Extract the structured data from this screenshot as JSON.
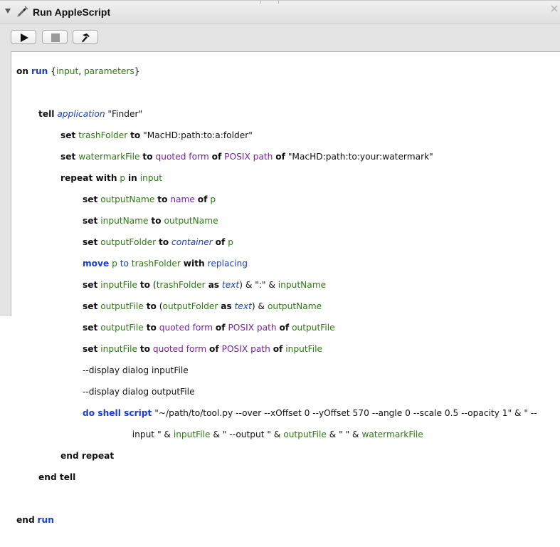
{
  "window": {
    "title": "Run AppleScript",
    "icon": "script-icon",
    "disclosure": "expanded"
  },
  "toolbar": {
    "buttons": [
      {
        "name": "run-button",
        "icon": "play-icon"
      },
      {
        "name": "stop-button",
        "icon": "stop-icon"
      },
      {
        "name": "compile-button",
        "icon": "hammer-icon"
      }
    ]
  },
  "colors": {
    "keyword": "#111111",
    "keyword_blue": "#1a3cd6",
    "variable": "#2d7a13",
    "property": "#7a1fa8",
    "class": "#1a3cd6"
  },
  "code": {
    "l1": {
      "on": "on",
      "run": "run",
      "rest1": " {",
      "input": "input",
      "comma": ", ",
      "parameters": "parameters",
      "close": "}"
    },
    "l3": {
      "tell": "tell",
      "application": "application",
      "rest": " \"Finder\""
    },
    "l4": {
      "set": "set",
      "trashFolder": "trashFolder",
      "to": "to",
      "str": " \"MacHD:path:to:a:folder\""
    },
    "l5": {
      "set": "set",
      "watermarkFile": "watermarkFile",
      "to": "to",
      "quoted": "quoted form",
      "of1": "of",
      "posix": "POSIX path",
      "of2": "of",
      "str": " \"MacHD:path:to:your:watermark\""
    },
    "l6": {
      "repeat": "repeat with",
      "p": "p",
      "in": "in",
      "input": "input"
    },
    "l7": {
      "set": "set",
      "outputName": "outputName",
      "to": "to",
      "name": "name",
      "of": "of",
      "p": "p"
    },
    "l8": {
      "set": "set",
      "inputName": "inputName",
      "to": "to",
      "outputName": "outputName"
    },
    "l9": {
      "set": "set",
      "outputFolder": "outputFolder",
      "to": "to",
      "container": "container",
      "of": "of",
      "p": "p"
    },
    "l10": {
      "move": "move",
      "p": "p",
      "to": "to",
      "trashFolder": "trashFolder",
      "with": "with",
      "replacing": "replacing"
    },
    "l11": {
      "set": "set",
      "inputFile": "inputFile",
      "to": "to",
      "open": " (",
      "trashFolder": "trashFolder",
      "as": "as",
      "text": "text",
      "rest": ") & \":\" & ",
      "inputName": "inputName"
    },
    "l12": {
      "set": "set",
      "outputFile": "outputFile",
      "to": "to",
      "open": " (",
      "outputFolder": "outputFolder",
      "as": "as",
      "text": "text",
      "rest": ") & ",
      "outputName": "outputName"
    },
    "l13": {
      "set": "set",
      "outputFile": "outputFile",
      "to": "to",
      "quoted": "quoted form",
      "of1": "of",
      "posix": "POSIX path",
      "of2": "of",
      "outputFile2": "outputFile"
    },
    "l14": {
      "set": "set",
      "inputFile": "inputFile",
      "to": "to",
      "quoted": "quoted form",
      "of1": "of",
      "posix": "POSIX path",
      "of2": "of",
      "inputFile2": "inputFile"
    },
    "l15": {
      "comment": "--display dialog inputFile"
    },
    "l16": {
      "comment": "--display dialog outputFile"
    },
    "l17": {
      "doshell": "do shell script",
      "str": " \"~/path/to/tool.py --over --xOffset 0 --yOffset 570 --angle 0 --scale 0.5 --opacity 1\" & \" --"
    },
    "l18": {
      "str": "input \" & ",
      "inputFile": "inputFile",
      "mid": " & \" --output \" & ",
      "outputFile": "outputFile",
      "mid2": " & \" \" & ",
      "watermarkFile": "watermarkFile"
    },
    "l19": {
      "end": "end repeat"
    },
    "l20": {
      "end": "end tell"
    },
    "l22": {
      "end": "end",
      "run": "run"
    }
  }
}
